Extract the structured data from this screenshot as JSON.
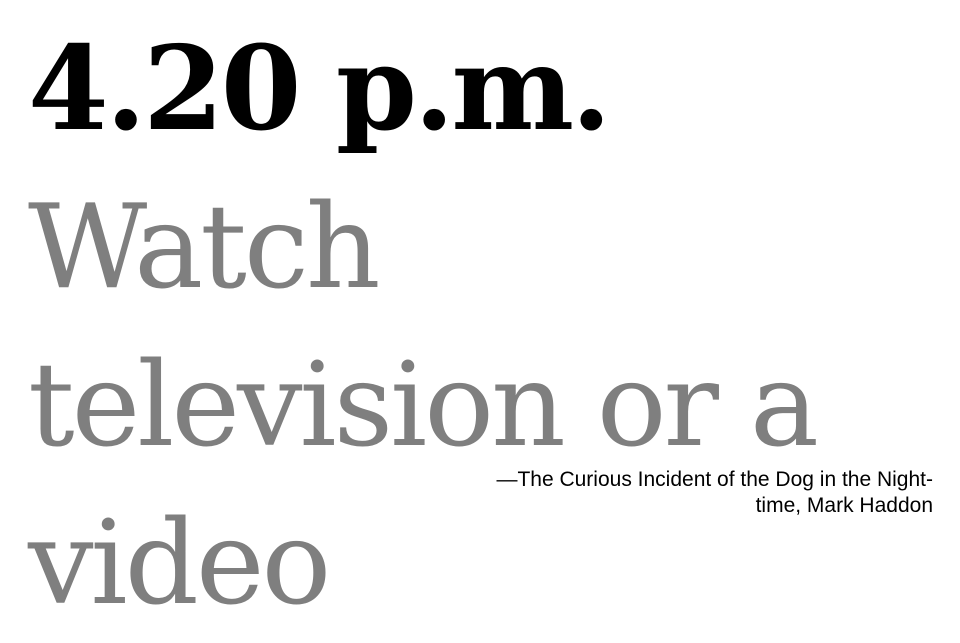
{
  "quote": {
    "time": "4.20 p.m.",
    "text": " Watch television or a video"
  },
  "attribution": {
    "text": "—The Curious Incident of the Dog in the Night-time, Mark Haddon"
  },
  "colors": {
    "time": "#000000",
    "text": "#7f7f7f",
    "background": "#ffffff"
  }
}
